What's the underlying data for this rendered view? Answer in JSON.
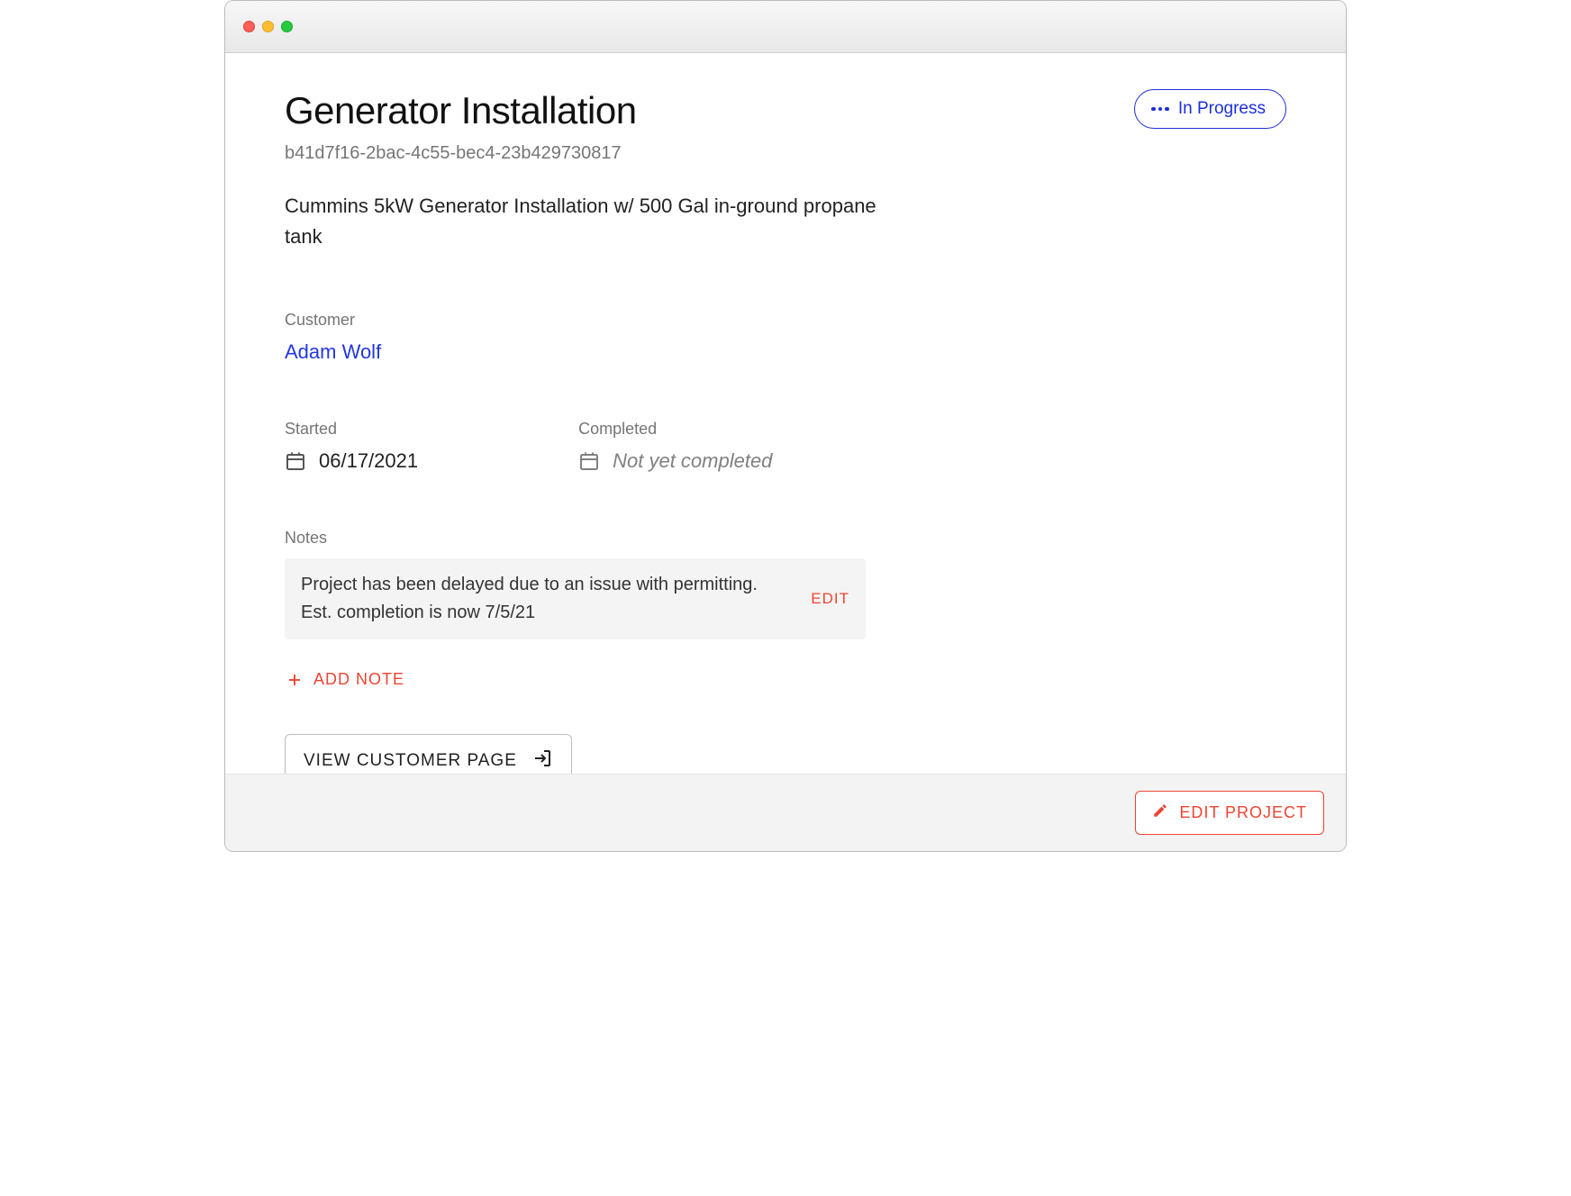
{
  "project": {
    "title": "Generator Installation",
    "id": "b41d7f16-2bac-4c55-bec4-23b429730817",
    "description": "Cummins 5kW Generator Installation w/ 500 Gal in-ground propane tank",
    "status_label": "In Progress"
  },
  "customer": {
    "label": "Customer",
    "name": "Adam Wolf"
  },
  "dates": {
    "started_label": "Started",
    "started_value": "06/17/2021",
    "completed_label": "Completed",
    "completed_placeholder": "Not yet completed"
  },
  "notes": {
    "label": "Notes",
    "items": [
      {
        "text": "Project has been delayed due to an issue with permitting. Est. completion is now 7/5/21",
        "edit_label": "EDIT"
      }
    ],
    "add_label": "ADD NOTE"
  },
  "actions": {
    "view_customer_label": "VIEW CUSTOMER PAGE",
    "edit_project_label": "EDIT PROJECT"
  },
  "colors": {
    "accent_blue": "#2336e0",
    "accent_red": "#ef4433"
  }
}
